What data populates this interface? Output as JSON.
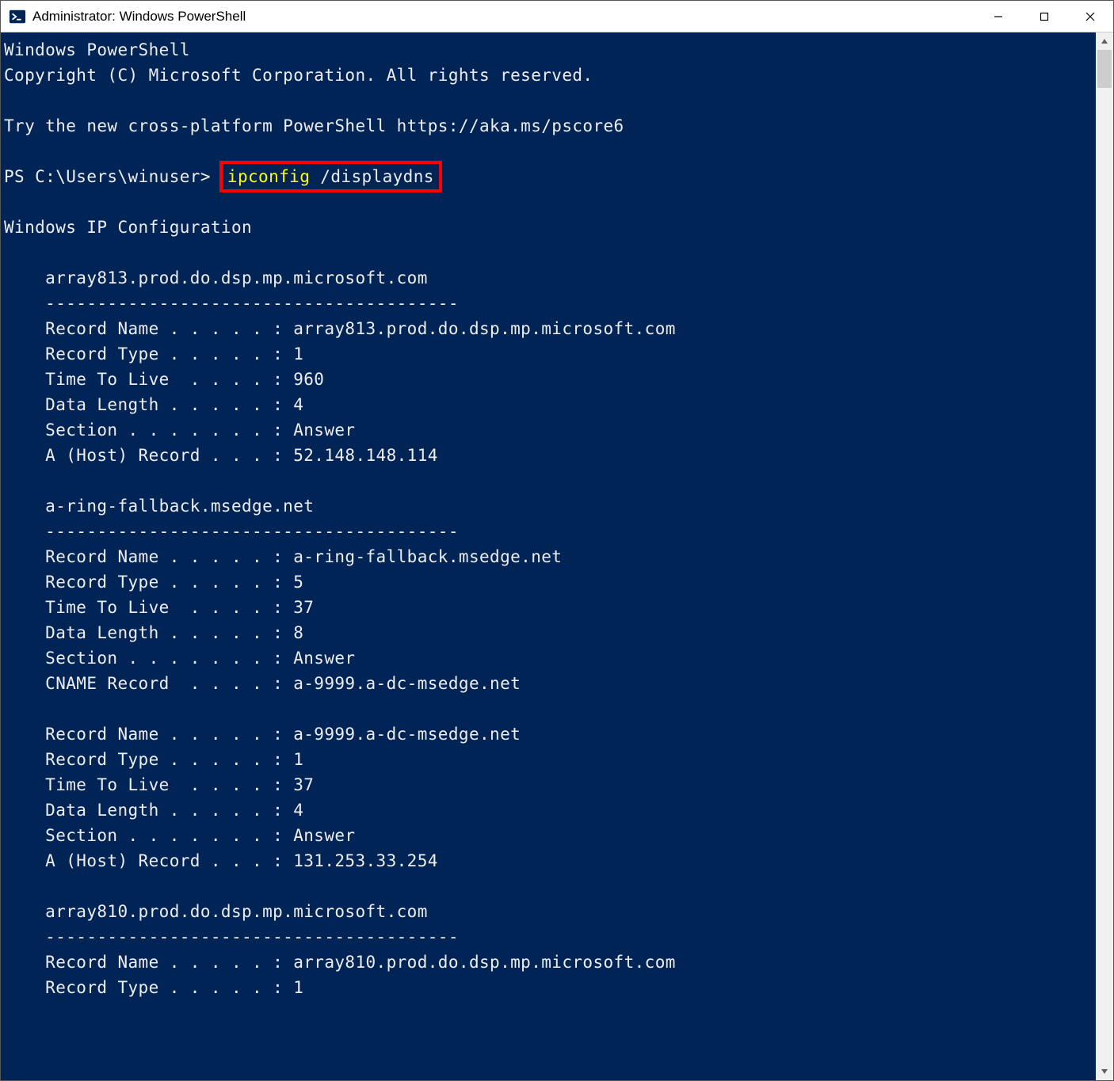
{
  "window": {
    "title": "Administrator: Windows PowerShell"
  },
  "terminal": {
    "banner_line1": "Windows PowerShell",
    "banner_line2": "Copyright (C) Microsoft Corporation. All rights reserved.",
    "banner_line3": "Try the new cross-platform PowerShell https://aka.ms/pscore6",
    "prompt": "PS C:\\Users\\winuser> ",
    "command_hl": "ipconfig",
    "command_rest": " /displaydns",
    "out_header": "Windows IP Configuration",
    "entries": [
      {
        "host": "    array813.prod.do.dsp.mp.microsoft.com",
        "sep": "    ----------------------------------------",
        "lines": [
          "    Record Name . . . . . : array813.prod.do.dsp.mp.microsoft.com",
          "    Record Type . . . . . : 1",
          "    Time To Live  . . . . : 960",
          "    Data Length . . . . . : 4",
          "    Section . . . . . . . : Answer",
          "    A (Host) Record . . . : 52.148.148.114"
        ]
      },
      {
        "host": "    a-ring-fallback.msedge.net",
        "sep": "    ----------------------------------------",
        "lines": [
          "    Record Name . . . . . : a-ring-fallback.msedge.net",
          "    Record Type . . . . . : 5",
          "    Time To Live  . . . . : 37",
          "    Data Length . . . . . : 8",
          "    Section . . . . . . . : Answer",
          "    CNAME Record  . . . . : a-9999.a-dc-msedge.net"
        ]
      },
      {
        "host": "",
        "sep": "",
        "lines": [
          "    Record Name . . . . . : a-9999.a-dc-msedge.net",
          "    Record Type . . . . . : 1",
          "    Time To Live  . . . . : 37",
          "    Data Length . . . . . : 4",
          "    Section . . . . . . . : Answer",
          "    A (Host) Record . . . : 131.253.33.254"
        ]
      },
      {
        "host": "    array810.prod.do.dsp.mp.microsoft.com",
        "sep": "    ----------------------------------------",
        "lines": [
          "    Record Name . . . . . : array810.prod.do.dsp.mp.microsoft.com",
          "    Record Type . . . . . : 1"
        ]
      }
    ]
  }
}
